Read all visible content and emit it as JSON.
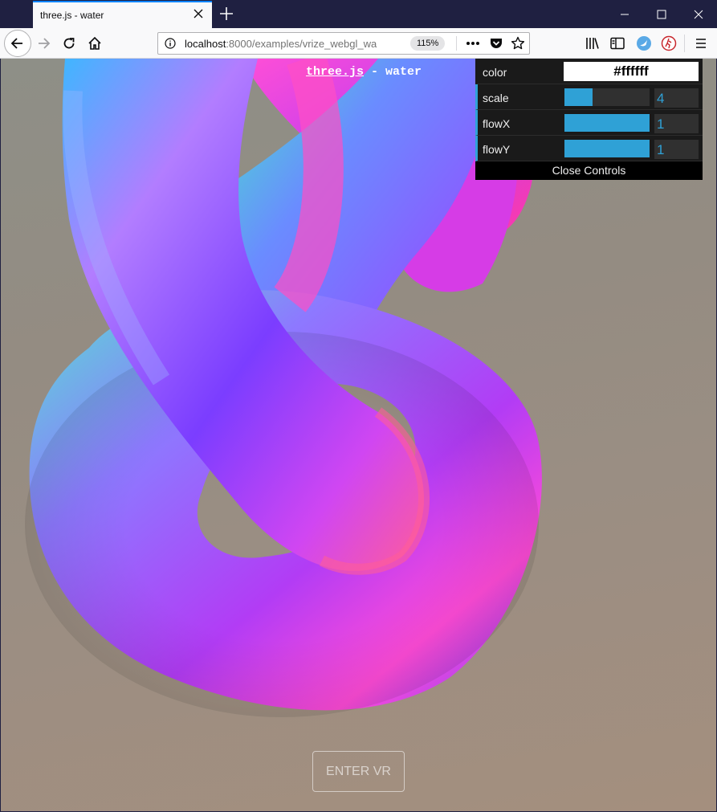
{
  "browser": {
    "tab_title": "three.js - water",
    "url_host": "localhost",
    "url_path": ":8000/examples/vrize_webgl_wa",
    "zoom": "115%"
  },
  "page": {
    "title_link": "three.js",
    "title_rest": " - water"
  },
  "gui": {
    "controls": [
      {
        "label": "color",
        "value": "#ffffff"
      },
      {
        "label": "scale",
        "value": "4",
        "fraction": 0.33
      },
      {
        "label": "flowX",
        "value": "1",
        "fraction": 1.0
      },
      {
        "label": "flowY",
        "value": "1",
        "fraction": 1.0
      }
    ],
    "close_label": "Close Controls"
  },
  "vr_button": "ENTER VR",
  "colors": {
    "accent": "#0a84ff",
    "gui_blue": "#2fa1d6"
  }
}
